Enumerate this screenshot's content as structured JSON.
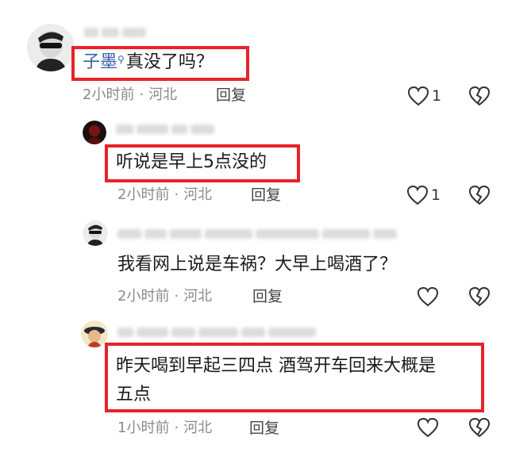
{
  "comments": [
    {
      "mention": "子墨",
      "text": "真没了吗？",
      "time": "2小时前",
      "location": "河北",
      "reply_label": "回复",
      "likes": "1"
    },
    {
      "text": "听说是早上5点没的",
      "time": "2小时前",
      "location": "河北",
      "reply_label": "回复",
      "likes": "1"
    },
    {
      "text": "我看网上说是车祸？大早上喝酒了？",
      "time": "2小时前",
      "location": "河北",
      "reply_label": "回复"
    },
    {
      "text_line1": "昨天喝到早起三四点 酒驾开车回来大概是",
      "text_line2": "五点",
      "time": "1小时前",
      "location": "河北",
      "reply_label": "回复"
    }
  ],
  "separator": "·",
  "icons": {
    "like": "heart-outline-icon",
    "dislike": "broken-heart-icon",
    "mention": "search-icon"
  },
  "colors": {
    "highlight": "#e8222a",
    "mention": "#3a5fa8",
    "meta": "#8a8a8a"
  }
}
